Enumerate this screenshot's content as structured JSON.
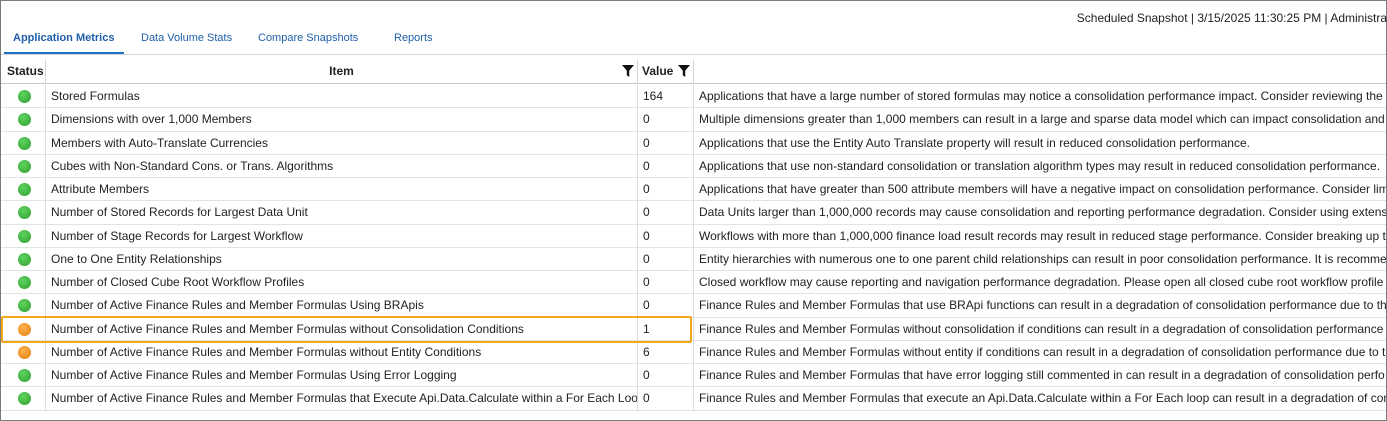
{
  "snapshot_text": "Scheduled Snapshot | 3/15/2025 11:30:25 PM | Administra",
  "tabs": [
    {
      "label": "Application Metrics",
      "active": true
    },
    {
      "label": "Data Volume Stats",
      "active": false
    },
    {
      "label": "Compare Snapshots",
      "active": false
    },
    {
      "label": "Reports",
      "active": false
    }
  ],
  "columns": {
    "status": "Status",
    "item": "Item",
    "value": "Value"
  },
  "colors": {
    "green": "#2e9e2e",
    "orange": "#e07f10",
    "highlight": "#f0a91c",
    "tab_accent": "#1f6fc5"
  },
  "rows": [
    {
      "status": "green",
      "item": "Stored Formulas",
      "value": "164",
      "description": "Applications that have a large number of stored formulas may notice a consolidation performance impact. Consider reviewing the"
    },
    {
      "status": "green",
      "item": "Dimensions with over 1,000 Members",
      "value": "0",
      "description": "Multiple dimensions greater than 1,000 members can result in a large and sparse data model which can impact consolidation and"
    },
    {
      "status": "green",
      "item": "Members with Auto-Translate Currencies",
      "value": "0",
      "description": "Applications that use the Entity Auto Translate property will result in reduced consolidation performance."
    },
    {
      "status": "green",
      "item": "Cubes with Non-Standard Cons. or Trans. Algorithms",
      "value": "0",
      "description": "Applications that use non-standard consolidation or translation algorithm types may result in reduced consolidation performance."
    },
    {
      "status": "green",
      "item": "Attribute Members",
      "value": "0",
      "description": "Applications that have greater than 500 attribute members will have a negative impact on consolidation performance. Consider lim"
    },
    {
      "status": "green",
      "item": "Number of Stored Records for Largest Data Unit",
      "value": "0",
      "description": "Data Units larger than 1,000,000 records may cause consolidation and reporting performance degradation.  Consider using extensi"
    },
    {
      "status": "green",
      "item": "Number of Stage Records for Largest Workflow",
      "value": "0",
      "description": "Workflows with more than 1,000,000 finance load result records may result in reduced stage performance. Consider breaking up th"
    },
    {
      "status": "green",
      "item": "One to One Entity Relationships",
      "value": "0",
      "description": "Entity hierarchies with numerous one to one parent child relationships can result in poor consolidation performance. It is recomme"
    },
    {
      "status": "green",
      "item": "Number of Closed Cube Root Workflow Profiles",
      "value": "0",
      "description": "Closed workflow may cause reporting and navigation performance degradation.  Please open all closed cube root workflow profile"
    },
    {
      "status": "green",
      "item": "Number of Active Finance Rules and Member Formulas Using BRApis",
      "value": "0",
      "description": "Finance Rules and Member Formulas that use BRApi functions can result in a degradation of consolidation performance due to the"
    },
    {
      "status": "orange",
      "item": "Number of Active Finance Rules and Member Formulas without Consolidation Conditions",
      "value": "1",
      "description": "Finance Rules and Member Formulas without consolidation if conditions can result in a degradation of consolidation performance"
    },
    {
      "status": "orange",
      "item": "Number of Active Finance Rules and Member Formulas without Entity Conditions",
      "value": "6",
      "description": "Finance Rules and Member Formulas without entity if conditions can result in a degradation of consolidation performance due to t"
    },
    {
      "status": "green",
      "item": "Number of Active Finance Rules and Member Formulas Using Error Logging",
      "value": "0",
      "description": "Finance Rules and Member Formulas that have error logging still commented in can result in a degradation of consolidation perfo"
    },
    {
      "status": "green",
      "item": "Number of Active Finance Rules and Member Formulas that Execute Api.Data.Calculate within a For Each Loop",
      "value": "0",
      "description": "Finance Rules and Member Formulas that execute an Api.Data.Calculate within a For Each loop can result in a degradation of conso"
    }
  ]
}
